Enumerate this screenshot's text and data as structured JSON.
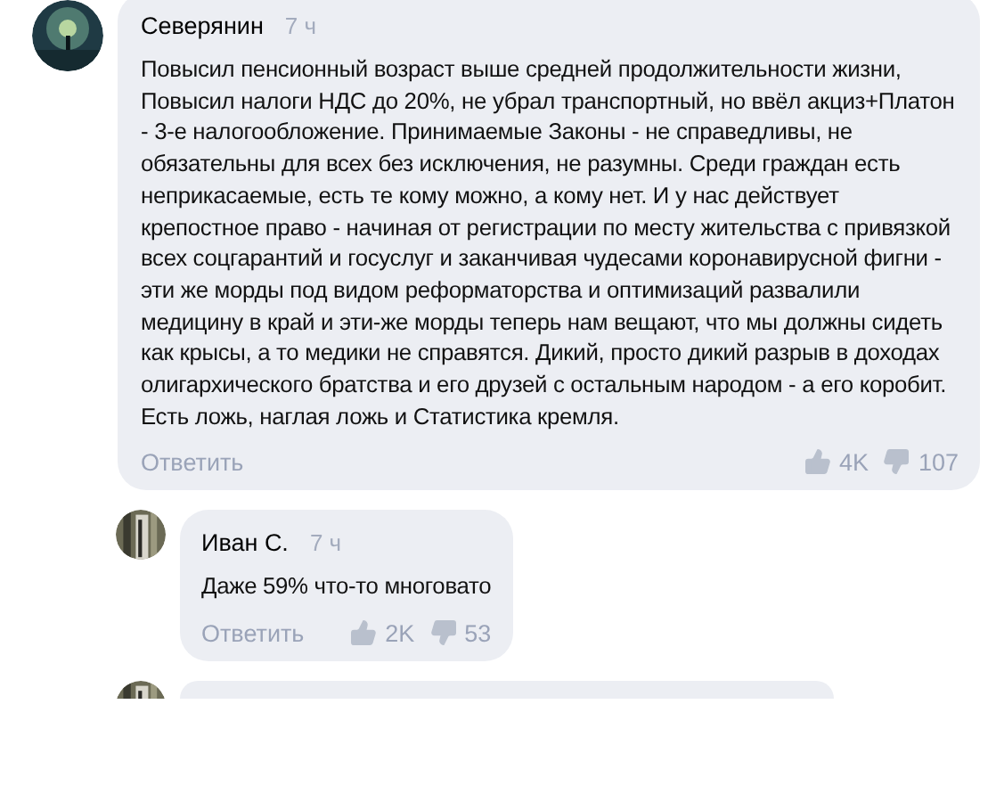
{
  "comments": [
    {
      "author": "Северянин",
      "time": "7 ч",
      "text": "Повысил пенсионный возраст выше средней продолжительности жизни, Повысил налоги НДС до 20%, не убрал транспортный, но ввёл акциз+Платон - 3-е налогообложение. Принимаемые Законы - не справедливы, не обязательны для всех без исключения, не разумны. Среди граждан есть неприкасаемые, есть те кому можно, а кому нет. И у нас действует крепостное право - начиная от регистрации по месту жительства с привязкой всех соцгарантий и госуслуг и заканчивая чудесами коронавирусной фигни - эти же морды под видом реформаторства и оптимизаций развалили медицину в край и эти-же морды теперь нам вещают, что мы должны сидеть как крысы, а то медики не справятся.  Дикий, просто дикий разрыв в доходах олигархического братства и его друзей с остальным народом - а его коробит. Есть ложь, наглая ложь и Статистика кремля.",
      "reply": "Ответить",
      "likes": "4K",
      "dislikes": "107",
      "replies": [
        {
          "author": "Иван С.",
          "time": "7 ч",
          "text": "Даже 59% что-то многовато",
          "reply": "Ответить",
          "likes": "2K",
          "dislikes": "53"
        }
      ]
    }
  ]
}
